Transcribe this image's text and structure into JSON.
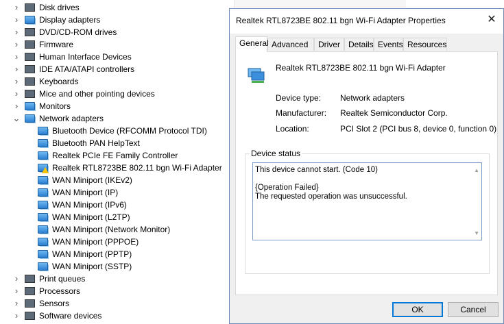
{
  "tree": {
    "categories_top": [
      {
        "label": "Disk drives",
        "icon": "disk-drive-icon",
        "expanded": false
      },
      {
        "label": "Display adapters",
        "icon": "display-adapter-icon",
        "expanded": false
      },
      {
        "label": "DVD/CD-ROM drives",
        "icon": "dvd-drive-icon",
        "expanded": false
      },
      {
        "label": "Firmware",
        "icon": "firmware-icon",
        "expanded": false
      },
      {
        "label": "Human Interface Devices",
        "icon": "hid-icon",
        "expanded": false
      },
      {
        "label": "IDE ATA/ATAPI controllers",
        "icon": "ide-controller-icon",
        "expanded": false
      },
      {
        "label": "Keyboards",
        "icon": "keyboard-icon",
        "expanded": false
      },
      {
        "label": "Mice and other pointing devices",
        "icon": "mouse-icon",
        "expanded": false
      },
      {
        "label": "Monitors",
        "icon": "monitor-icon",
        "expanded": false
      },
      {
        "label": "Network adapters",
        "icon": "network-adapter-icon",
        "expanded": true
      }
    ],
    "network_children": [
      {
        "label": "Bluetooth Device (RFCOMM Protocol TDI)",
        "warning": false
      },
      {
        "label": "Bluetooth PAN HelpText",
        "warning": false
      },
      {
        "label": "Realtek PCIe FE Family Controller",
        "warning": false
      },
      {
        "label": "Realtek RTL8723BE 802.11 bgn Wi-Fi Adapter",
        "warning": true
      },
      {
        "label": "WAN Miniport (IKEv2)",
        "warning": false
      },
      {
        "label": "WAN Miniport (IP)",
        "warning": false
      },
      {
        "label": "WAN Miniport (IPv6)",
        "warning": false
      },
      {
        "label": "WAN Miniport (L2TP)",
        "warning": false
      },
      {
        "label": "WAN Miniport (Network Monitor)",
        "warning": false
      },
      {
        "label": "WAN Miniport (PPPOE)",
        "warning": false
      },
      {
        "label": "WAN Miniport (PPTP)",
        "warning": false
      },
      {
        "label": "WAN Miniport (SSTP)",
        "warning": false
      }
    ],
    "categories_bottom": [
      {
        "label": "Print queues",
        "icon": "printer-icon",
        "expanded": false
      },
      {
        "label": "Processors",
        "icon": "processor-icon",
        "expanded": false
      },
      {
        "label": "Sensors",
        "icon": "sensor-icon",
        "expanded": false
      },
      {
        "label": "Software devices",
        "icon": "software-device-icon",
        "expanded": false
      }
    ]
  },
  "dialog": {
    "title": "Realtek RTL8723BE 802.11 bgn Wi-Fi Adapter Properties",
    "tabs": [
      "General",
      "Advanced",
      "Driver",
      "Details",
      "Events",
      "Resources"
    ],
    "active_tab": "General",
    "device_name": "Realtek RTL8723BE 802.11 bgn Wi-Fi Adapter",
    "properties": [
      {
        "label": "Device type:",
        "value": "Network adapters"
      },
      {
        "label": "Manufacturer:",
        "value": "Realtek Semiconductor Corp."
      },
      {
        "label": "Location:",
        "value": "PCI Slot 2 (PCI bus 8, device 0, function 0)"
      }
    ],
    "status_group_label": "Device status",
    "status_lines": [
      "This device cannot start. (Code 10)",
      "",
      "{Operation Failed}",
      "The requested operation was unsuccessful."
    ],
    "ok_label": "OK",
    "cancel_label": "Cancel"
  },
  "colors": {
    "accent": "#0078d7",
    "network_icon": "#2c7fd3",
    "warning": "#f5c400"
  }
}
